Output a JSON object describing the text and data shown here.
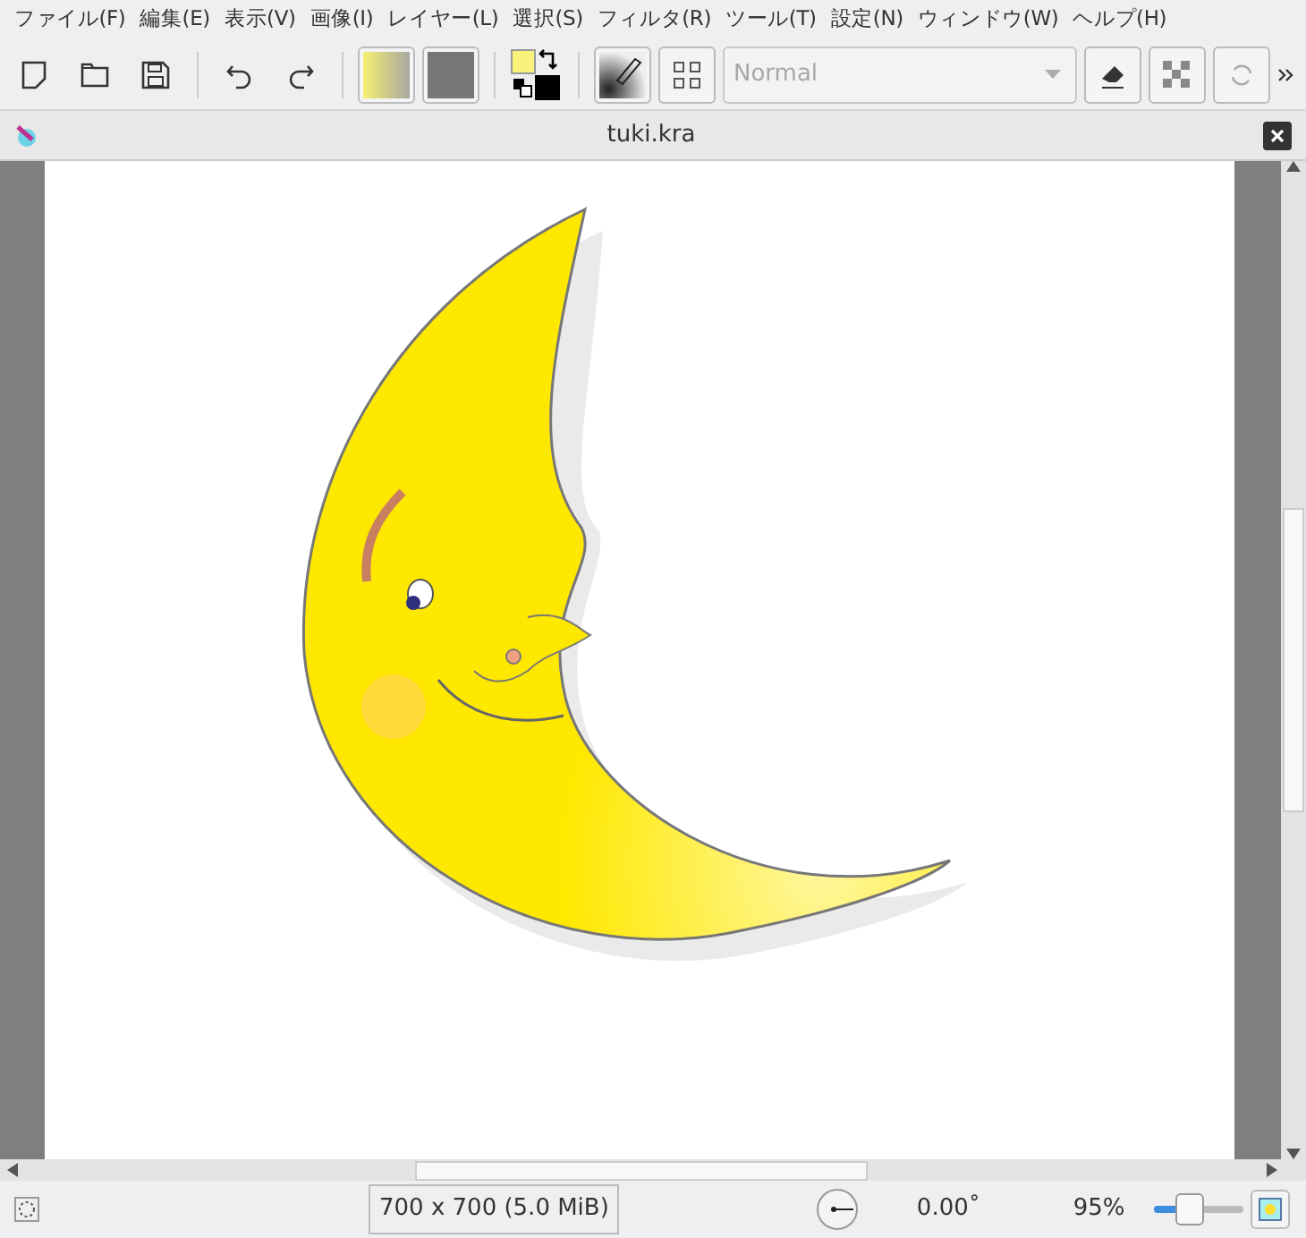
{
  "menu": [
    "ファイル(F)",
    "編集(E)",
    "表示(V)",
    "画像(I)",
    "レイヤー(L)",
    "選択(S)",
    "フィルタ(R)",
    "ツール(T)",
    "設定(N)",
    "ウィンドウ(W)",
    "ヘルプ(H)"
  ],
  "blend_mode": {
    "value": "Normal",
    "disabled": true
  },
  "document": {
    "title": "tuki.kra"
  },
  "status_bar": {
    "image_size": "700 x 700 (5.0 MiB)",
    "rotation": "0.00˚",
    "zoom": "95%",
    "zoom_slider": {
      "level": 0.4
    }
  }
}
